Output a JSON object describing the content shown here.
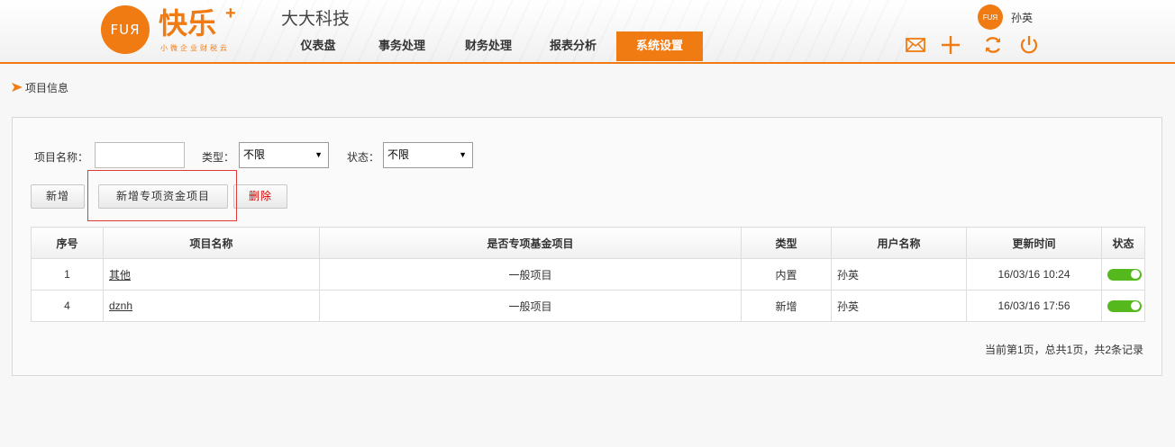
{
  "brand": {
    "logo_text": "FUЯ",
    "name": "快乐",
    "plus": "+",
    "tagline": "小微企业财税云",
    "company": "大大科技",
    "accent": "#ef7b12"
  },
  "nav": {
    "items": [
      {
        "label": "仪表盘"
      },
      {
        "label": "事务处理"
      },
      {
        "label": "财务处理"
      },
      {
        "label": "报表分析"
      },
      {
        "label": "系统设置",
        "active": true
      }
    ]
  },
  "user": {
    "avatar_text": "FUЯ",
    "name": "孙英"
  },
  "header_icons": [
    "mail-icon",
    "plus-icon",
    "refresh-icon",
    "power-icon"
  ],
  "breadcrumb": {
    "text": "项目信息"
  },
  "filters": {
    "name_label": "项目名称：",
    "name_value": "",
    "type_label": "类型：",
    "type_value": "不限",
    "status_label": "状态：",
    "status_value": "不限"
  },
  "actions": {
    "add_label": "新增",
    "add_special_label": "新增专项资金项目",
    "delete_label": "删除"
  },
  "table": {
    "headers": [
      "序号",
      "项目名称",
      "是否专项基金项目",
      "类型",
      "用户名称",
      "更新时间",
      "状态"
    ],
    "rows": [
      {
        "no": "1",
        "name": "其他",
        "special": "一般项目",
        "type": "内置",
        "user": "孙英",
        "updated": "16/03/16 10:24",
        "enabled": true
      },
      {
        "no": "4",
        "name": "dznh",
        "special": "一般项目",
        "type": "新增",
        "user": "孙英",
        "updated": "16/03/16 17:56",
        "enabled": true
      }
    ]
  },
  "pager": {
    "text": "当前第1页，总共1页，共2条记录"
  }
}
